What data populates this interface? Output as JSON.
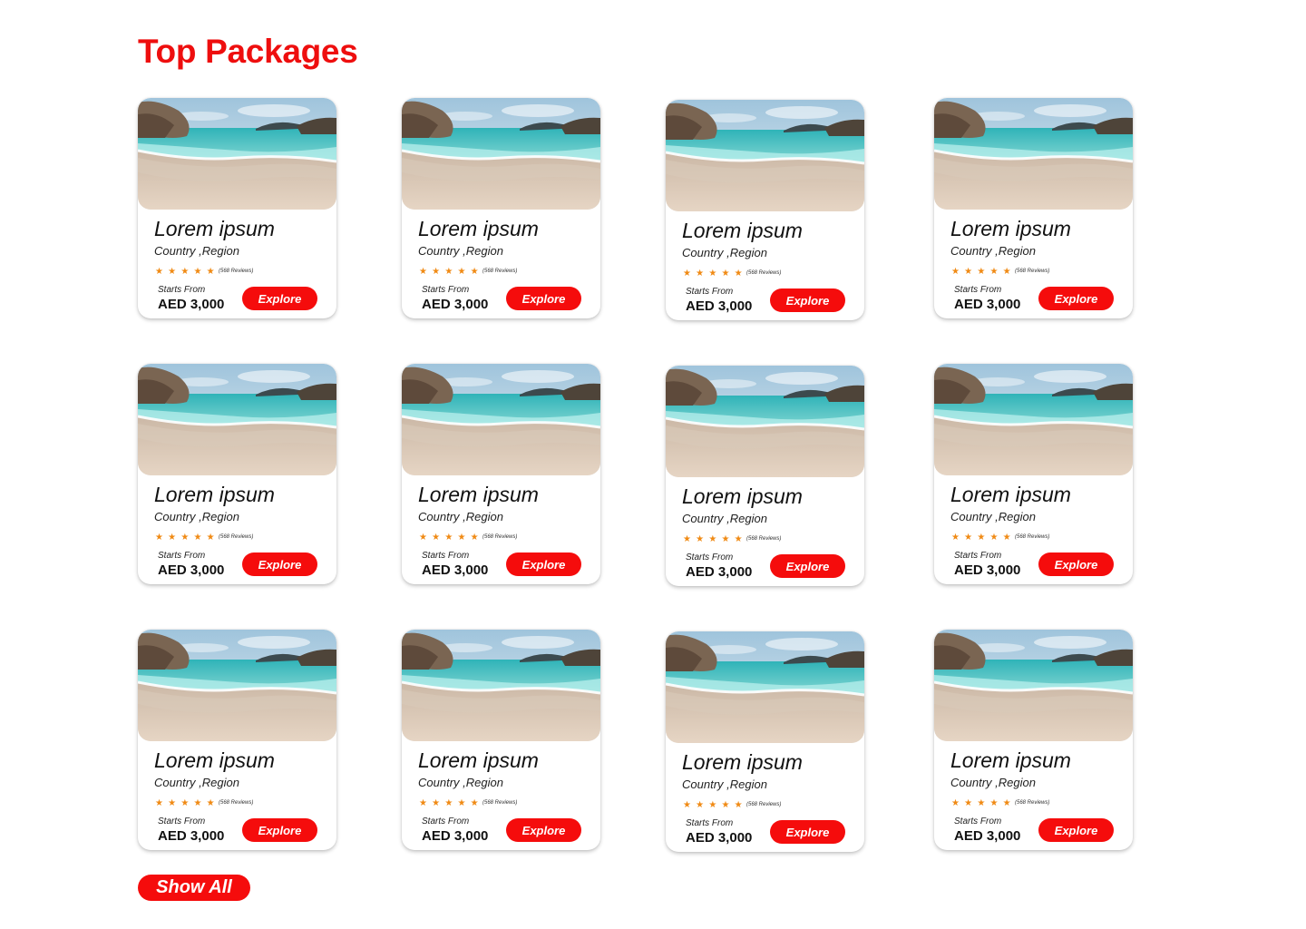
{
  "section": {
    "title": "Top Packages",
    "show_all_label": "Show All"
  },
  "colors": {
    "accent": "#f50c0c",
    "title": "#ee0e0e",
    "star": "#f08a14"
  },
  "image": {
    "subject": "beach-scene"
  },
  "packages": [
    {
      "title": "Lorem ipsum",
      "location": "Country ,Region",
      "rating": 5,
      "stars": "★★★★★",
      "reviews": "(568 Reviews)",
      "starts_label": "Starts From",
      "price": "AED 3,000",
      "cta": "Explore"
    },
    {
      "title": "Lorem ipsum",
      "location": "Country ,Region",
      "rating": 5,
      "stars": "★★★★★",
      "reviews": "(568 Reviews)",
      "starts_label": "Starts From",
      "price": "AED 3,000",
      "cta": "Explore"
    },
    {
      "title": "Lorem ipsum",
      "location": "Country ,Region",
      "rating": 5,
      "stars": "★★★★★",
      "reviews": "(568 Reviews)",
      "starts_label": "Starts From",
      "price": "AED 3,000",
      "cta": "Explore"
    },
    {
      "title": "Lorem ipsum",
      "location": "Country ,Region",
      "rating": 5,
      "stars": "★★★★★",
      "reviews": "(568 Reviews)",
      "starts_label": "Starts From",
      "price": "AED 3,000",
      "cta": "Explore"
    },
    {
      "title": "Lorem ipsum",
      "location": "Country ,Region",
      "rating": 5,
      "stars": "★★★★★",
      "reviews": "(568 Reviews)",
      "starts_label": "Starts From",
      "price": "AED 3,000",
      "cta": "Explore"
    },
    {
      "title": "Lorem ipsum",
      "location": "Country ,Region",
      "rating": 5,
      "stars": "★★★★★",
      "reviews": "(568 Reviews)",
      "starts_label": "Starts From",
      "price": "AED 3,000",
      "cta": "Explore"
    },
    {
      "title": "Lorem ipsum",
      "location": "Country ,Region",
      "rating": 5,
      "stars": "★★★★★",
      "reviews": "(568 Reviews)",
      "starts_label": "Starts From",
      "price": "AED 3,000",
      "cta": "Explore"
    },
    {
      "title": "Lorem ipsum",
      "location": "Country ,Region",
      "rating": 5,
      "stars": "★★★★★",
      "reviews": "(568 Reviews)",
      "starts_label": "Starts From",
      "price": "AED 3,000",
      "cta": "Explore"
    },
    {
      "title": "Lorem ipsum",
      "location": "Country ,Region",
      "rating": 5,
      "stars": "★★★★★",
      "reviews": "(568 Reviews)",
      "starts_label": "Starts From",
      "price": "AED 3,000",
      "cta": "Explore"
    },
    {
      "title": "Lorem ipsum",
      "location": "Country ,Region",
      "rating": 5,
      "stars": "★★★★★",
      "reviews": "(568 Reviews)",
      "starts_label": "Starts From",
      "price": "AED 3,000",
      "cta": "Explore"
    },
    {
      "title": "Lorem ipsum",
      "location": "Country ,Region",
      "rating": 5,
      "stars": "★★★★★",
      "reviews": "(568 Reviews)",
      "starts_label": "Starts From",
      "price": "AED 3,000",
      "cta": "Explore"
    },
    {
      "title": "Lorem ipsum",
      "location": "Country ,Region",
      "rating": 5,
      "stars": "★★★★★",
      "reviews": "(568 Reviews)",
      "starts_label": "Starts From",
      "price": "AED 3,000",
      "cta": "Explore"
    }
  ]
}
